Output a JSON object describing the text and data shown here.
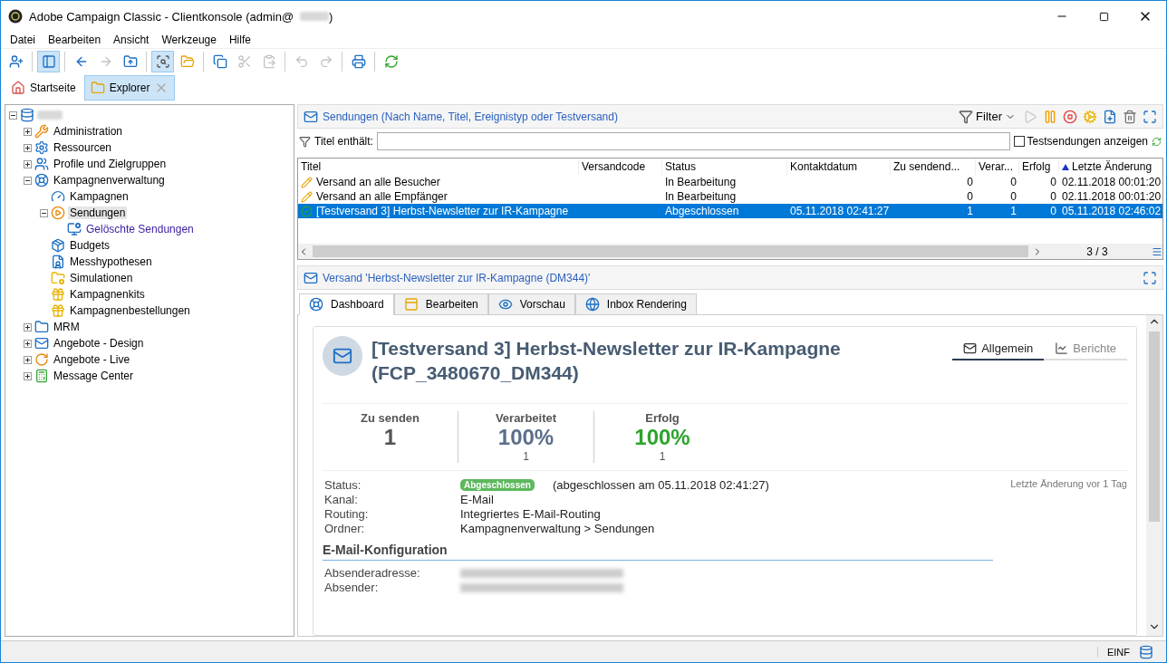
{
  "window": {
    "title_prefix": "Adobe Campaign Classic - Clientkonsole (admin@",
    "title_suffix": ")"
  },
  "menu": [
    "Datei",
    "Bearbeiten",
    "Ansicht",
    "Werkzeuge",
    "Hilfe"
  ],
  "toolbar": [
    [
      {
        "pressed": false,
        "disabled": false
      }
    ],
    [
      {
        "pressed": true,
        "disabled": false
      }
    ],
    [
      {
        "pressed": false,
        "disabled": false
      },
      {
        "pressed": false,
        "disabled": true
      },
      {
        "pressed": false,
        "disabled": false
      }
    ],
    [
      {
        "pressed": true,
        "disabled": false
      },
      {
        "pressed": false,
        "disabled": false
      }
    ],
    [
      {
        "pressed": false,
        "disabled": false
      },
      {
        "pressed": false,
        "disabled": true
      },
      {
        "pressed": false,
        "disabled": true
      }
    ],
    [
      {
        "pressed": false,
        "disabled": true
      },
      {
        "pressed": false,
        "disabled": true
      }
    ],
    [
      {
        "pressed": false,
        "disabled": false
      }
    ],
    [
      {
        "pressed": false,
        "disabled": false
      }
    ]
  ],
  "page_tabs": [
    {
      "label": "Startseite",
      "selected": false,
      "closable": false
    },
    {
      "label": "Explorer",
      "selected": true,
      "closable": true
    }
  ],
  "tree": {
    "expanded": true,
    "items": [
      {
        "label": "Administration",
        "kind": "node",
        "expanded": false,
        "selected": false
      },
      {
        "label": "Ressourcen",
        "kind": "node",
        "expanded": false,
        "selected": false
      },
      {
        "label": "Profile und Zielgruppen",
        "kind": "node",
        "expanded": false,
        "selected": false
      },
      {
        "label": "Kampagnenverwaltung",
        "kind": "node",
        "expanded": true,
        "selected": false,
        "children": [
          {
            "label": "Kampagnen",
            "kind": "leaf",
            "selected": false
          },
          {
            "label": "Sendungen",
            "kind": "node",
            "expanded": true,
            "selected": true,
            "children": [
              {
                "label": "Gelöschte Sendungen",
                "kind": "filter",
                "selected": false
              }
            ]
          },
          {
            "label": "Budgets",
            "kind": "leaf",
            "selected": false
          },
          {
            "label": "Messhypothesen",
            "kind": "leaf",
            "selected": false
          },
          {
            "label": "Simulationen",
            "kind": "leaf",
            "selected": false
          },
          {
            "label": "Kampagnenkits",
            "kind": "leaf",
            "selected": false
          },
          {
            "label": "Kampagnenbestellungen",
            "kind": "leaf",
            "selected": false
          }
        ]
      },
      {
        "label": "MRM",
        "kind": "node",
        "expanded": false,
        "selected": false
      },
      {
        "label": "Angebote - Design",
        "kind": "node",
        "expanded": false,
        "selected": false
      },
      {
        "label": "Angebote - Live",
        "kind": "node",
        "expanded": false,
        "selected": false
      },
      {
        "label": "Message Center",
        "kind": "node",
        "expanded": false,
        "selected": false
      }
    ]
  },
  "list": {
    "title": "Sendungen (Nach Name, Titel, Ereignistyp oder Testversand)",
    "filter_button": "Filter",
    "filter_label": "Titel enthält:",
    "test_checkbox": {
      "label": "Testsendungen anzeigen",
      "checked": false
    },
    "columns": [
      {
        "label": "Titel",
        "sorted": false
      },
      {
        "label": "Versandcode",
        "sorted": false
      },
      {
        "label": "Status",
        "sorted": false
      },
      {
        "label": "Kontaktdatum",
        "sorted": false
      },
      {
        "label": "Zu sendend...",
        "sorted": false
      },
      {
        "label": "Verar...",
        "sorted": false
      },
      {
        "label": "Erfolg",
        "sorted": false
      },
      {
        "label": "Letzte Änderung",
        "sorted": true
      }
    ],
    "rows": [
      {
        "kind": "draft",
        "selected": false,
        "cells": [
          "Versand an alle Besucher",
          "",
          "In Bearbeitung",
          "",
          "0",
          "0",
          "0",
          "02.11.2018 00:01:20"
        ]
      },
      {
        "kind": "draft",
        "selected": false,
        "cells": [
          "Versand an alle Empfänger",
          "",
          "In Bearbeitung",
          "",
          "0",
          "0",
          "0",
          "02.11.2018 00:01:20"
        ]
      },
      {
        "kind": "done",
        "selected": true,
        "cells": [
          "[Testversand 3] Herbst-Newsletter zur IR-Kampagne",
          "",
          "Abgeschlossen",
          "05.11.2018 02:41:27",
          "1",
          "1",
          "0",
          "05.11.2018 02:46:02"
        ]
      }
    ],
    "count": "3 / 3"
  },
  "detail": {
    "title": "Versand 'Herbst-Newsletter zur IR-Kampagne (DM344)'",
    "tabs": [
      {
        "label": "Dashboard",
        "selected": true
      },
      {
        "label": "Bearbeiten",
        "selected": false
      },
      {
        "label": "Vorschau",
        "selected": false
      },
      {
        "label": "Inbox Rendering",
        "selected": false
      }
    ],
    "heading": "[Testversand 3] Herbst-Newsletter zur IR-Kampagne (FCP_3480670_DM344)",
    "view_tabs": [
      {
        "label": "Allgemein",
        "selected": true
      },
      {
        "label": "Berichte",
        "selected": false
      }
    ],
    "stats": [
      {
        "label": "Zu senden",
        "value": "1",
        "kind": "count"
      },
      {
        "label": "Verarbeitet",
        "value": "100%",
        "sub": "1",
        "kind": "processed"
      },
      {
        "label": "Erfolg",
        "value": "100%",
        "sub": "1",
        "kind": "success"
      }
    ],
    "status": {
      "label": "Status:",
      "badge": "Abgeschlossen",
      "note": "(abgeschlossen am 05.11.2018 02:41:27)",
      "modified": "Letzte Änderung vor 1 Tag"
    },
    "info": [
      {
        "label": "Kanal:",
        "value": "E-Mail"
      },
      {
        "label": "Routing:",
        "value": "Integriertes E-Mail-Routing"
      },
      {
        "label": "Ordner:",
        "value": "Kampagnenverwaltung > Sendungen"
      }
    ],
    "config_title": "E-Mail-Konfiguration",
    "config": [
      {
        "label": "Absenderadresse:"
      },
      {
        "label": "Absender:"
      }
    ]
  },
  "status_bar": {
    "mode": "EINF"
  }
}
